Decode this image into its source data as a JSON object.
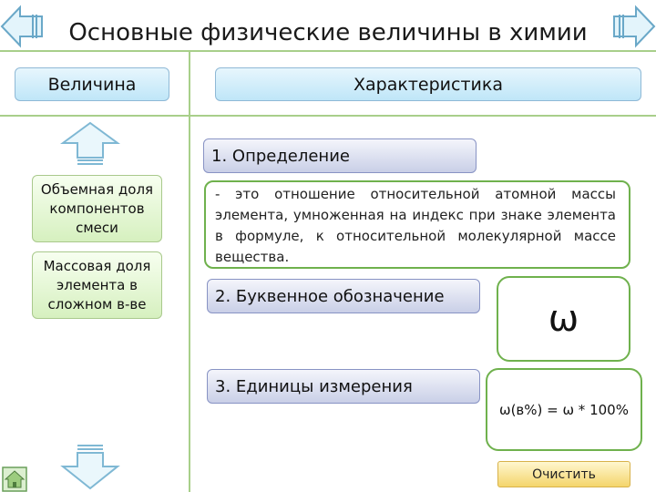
{
  "title": "Основные физические величины в химии",
  "headers": {
    "quantity": "Величина",
    "characteristic": "Характеристика"
  },
  "left_items": [
    "Объемная доля компонентов смеси",
    "Массовая доля элемента в сложном в-ве"
  ],
  "sections": {
    "definition_label": "1. Определение",
    "definition_text": "- это отношение относительной атомной массы элемента, умноженная на индекс при знаке элемента в формуле, к относительной молекулярной массе вещества.",
    "symbol_label": "2. Буквенное обозначение",
    "symbol_value": "ω",
    "units_label": "3. Единицы измерения",
    "units_formula": "ω(в%) = ω * 100%"
  },
  "clear_button": "Очистить",
  "icons": [
    "arrow-left-icon",
    "arrow-right-icon",
    "arrow-up-icon",
    "arrow-down-icon",
    "home-icon"
  ],
  "colors": {
    "accent_green": "#a8cf8a",
    "header_blue": "#bfe6f8",
    "item_green": "#d6f0bf",
    "label_lavender": "#c9cfe7",
    "button_gold": "#f4d56c"
  }
}
